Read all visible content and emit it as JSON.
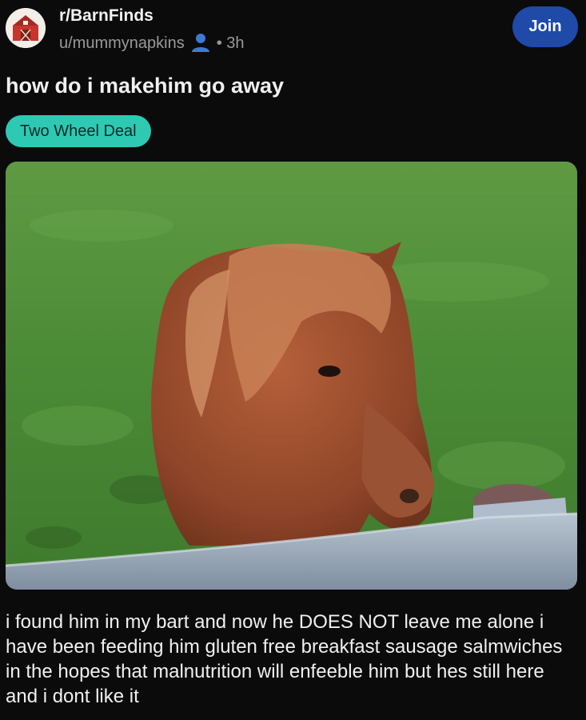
{
  "post": {
    "subreddit": "r/BarnFinds",
    "author": "u/mummynapkins",
    "time": "• 3h",
    "join_label": "Join",
    "title": "how do i makehim go away",
    "flair": "Two Wheel Deal",
    "body": "i found him in my bart and now he DOES NOT leave me alone i have been feeding him gluten free breakfast sausage salmwiches in the hopes that malnutrition will enfeeble him but hes still here and i dont like it"
  },
  "icons": {
    "avatar": "barn-icon",
    "user": "user-icon"
  },
  "colors": {
    "background": "#0b0b0c",
    "join_button": "#1f4aa8",
    "flair": "#2ec9b3",
    "meta_text": "#9a9a9a",
    "user_icon": "#3a7bd5"
  }
}
